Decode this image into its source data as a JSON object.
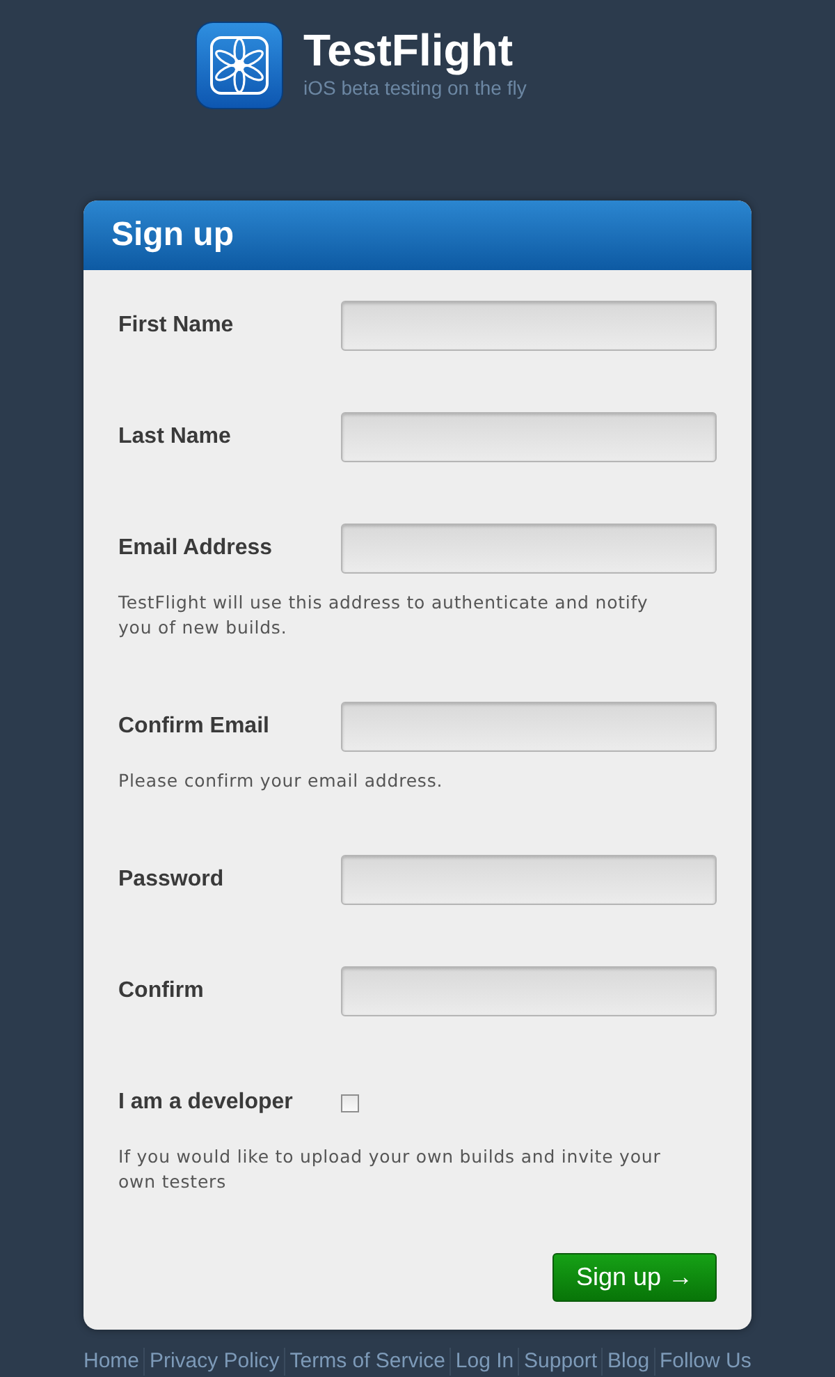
{
  "brand": {
    "name": "TestFlight",
    "tagline": "iOS beta testing on the fly"
  },
  "form": {
    "title": "Sign up",
    "fields": [
      {
        "kind": "text",
        "label": "First Name"
      },
      {
        "kind": "text",
        "label": "Last Name"
      },
      {
        "kind": "text",
        "label": "Email Address",
        "hint": "TestFlight will use this address to authenticate and notify you of new builds."
      },
      {
        "kind": "text",
        "label": "Confirm Email",
        "hint": "Please confirm your email address."
      },
      {
        "kind": "password",
        "label": "Password"
      },
      {
        "kind": "password",
        "label": "Confirm"
      },
      {
        "kind": "checkbox",
        "label": "I am a developer",
        "checked": false,
        "hint": "If you would like to upload your own builds and invite your own testers"
      }
    ],
    "submit": "Sign up →"
  },
  "footer_links": [
    "Home",
    "Privacy Policy",
    "Terms of Service",
    "Log In",
    "Support",
    "Blog",
    "Follow Us"
  ]
}
